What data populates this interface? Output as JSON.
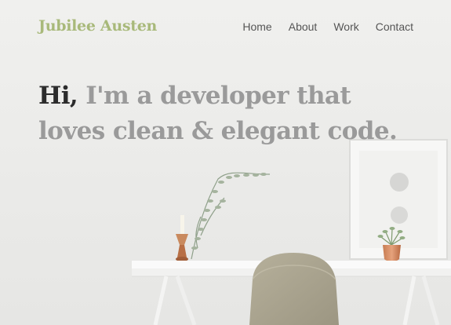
{
  "brand": {
    "name": "Jubilee Austen"
  },
  "nav": {
    "items": [
      {
        "label": "Home"
      },
      {
        "label": "About"
      },
      {
        "label": "Work"
      },
      {
        "label": "Contact"
      }
    ]
  },
  "hero": {
    "greeting": "Hi,",
    "line1_rest": " I'm a developer that",
    "line2": "loves clean & elegant code."
  },
  "colors": {
    "brand_accent": "#a8b97a",
    "greeting": "#2c2c2c",
    "headline_muted": "#9a9a9a",
    "nav_text": "#555555",
    "background": "#ebebe9"
  },
  "icons": [
    "hero-background-photo"
  ]
}
